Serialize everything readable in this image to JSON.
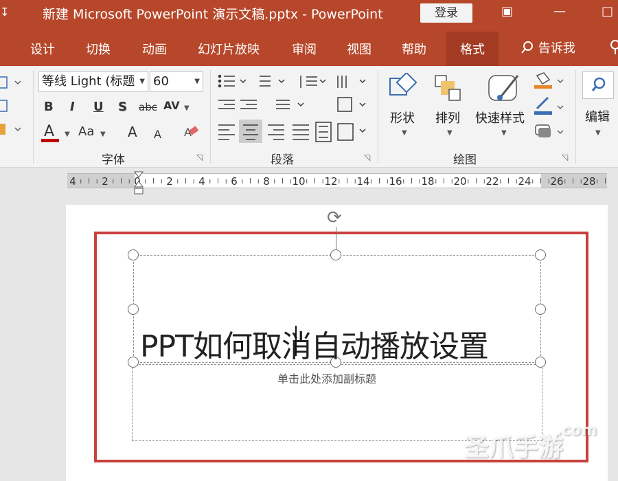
{
  "window": {
    "qat_glyph": "↧",
    "title": "新建 Microsoft PowerPoint 演示文稿.pptx  -  PowerPoint",
    "login_label": "登录",
    "restore_glyph": "▣",
    "minimize_glyph": "—",
    "maximize_glyph": "□"
  },
  "menu": {
    "tabs": [
      "设计",
      "切换",
      "动画",
      "幻灯片放映",
      "审阅",
      "视图",
      "帮助",
      "格式"
    ],
    "active_tab": "格式",
    "tell_me": "告诉我"
  },
  "ribbon": {
    "font": {
      "name": "等线 Light (标题",
      "size": "60",
      "bold": "B",
      "italic": "I",
      "underline": "U",
      "shadow": "S",
      "strike": "abc",
      "spacing": "AV",
      "color": "A",
      "case": "Aa",
      "grow": "A",
      "shrink": "A",
      "group_label": "字体"
    },
    "paragraph": {
      "group_label": "段落"
    },
    "drawing": {
      "shape_label": "形状",
      "arrange_label": "排列",
      "quick_styles_label": "快速样式",
      "group_label": "绘图"
    },
    "editing": {
      "label": "编辑"
    }
  },
  "ruler": {
    "numbers": [
      "4",
      "2",
      "0",
      "2",
      "4",
      "6",
      "8",
      "10",
      "12",
      "14",
      "16",
      "18",
      "20",
      "22",
      "24",
      "26",
      "28"
    ]
  },
  "slide": {
    "title": "PPT如何取消自动播放设置",
    "subtitle_placeholder": "单击此处添加副标题"
  },
  "watermark": {
    "text": "圣爪手游",
    "suffix": ".com"
  },
  "colors": {
    "accent": "#b7472a",
    "highlight_box": "#c9403c"
  },
  "icons": [
    "search-icon",
    "rotate-icon",
    "launcher-icon"
  ]
}
